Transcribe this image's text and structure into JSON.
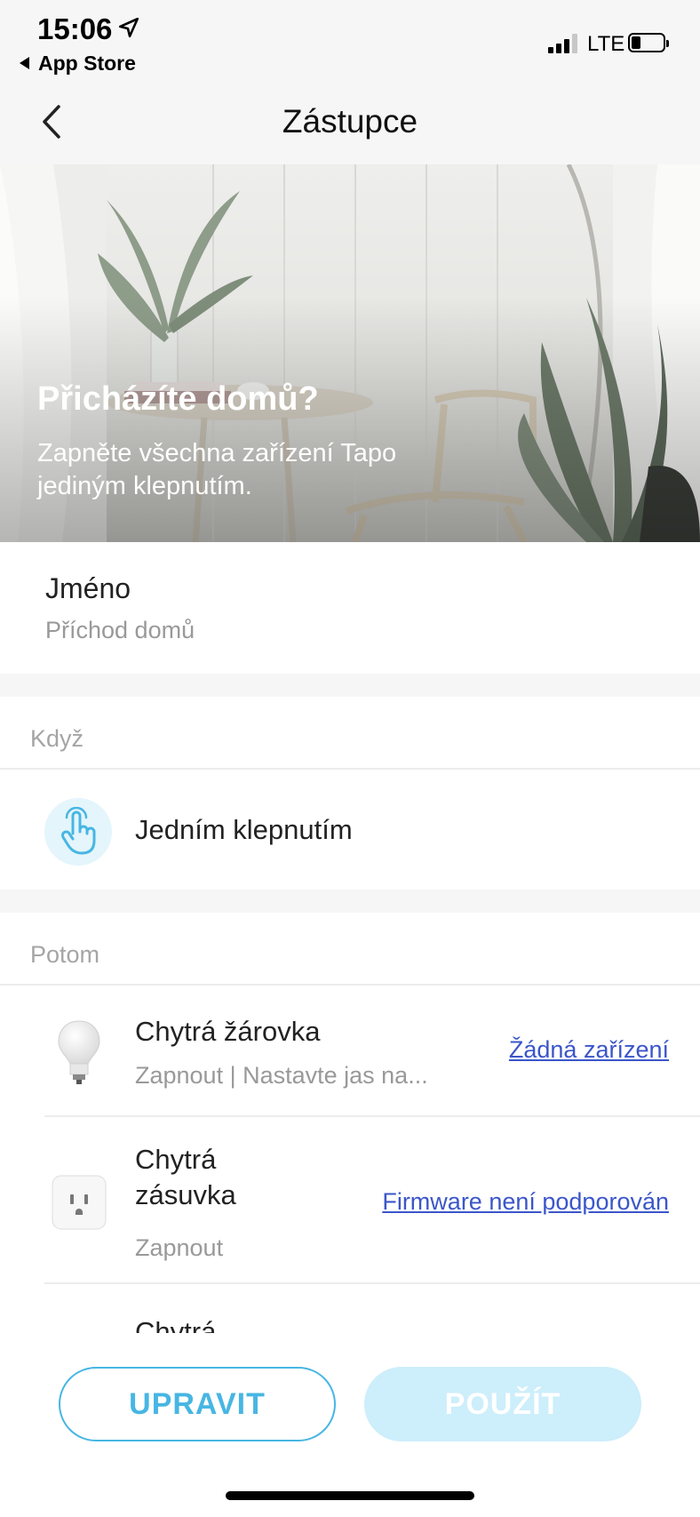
{
  "status_bar": {
    "time": "15:06",
    "back_app": "App Store",
    "network": "LTE",
    "icons": [
      "location-arrow-icon",
      "signal-icon",
      "battery-icon"
    ]
  },
  "nav": {
    "title": "Zástupce",
    "back_icon": "chevron-left-icon"
  },
  "hero": {
    "title": "Přicházíte domů?",
    "subtitle": "Zapněte všechna zařízení Tapo jediným klepnutím."
  },
  "name": {
    "label": "Jméno",
    "value": "Příchod domů"
  },
  "when": {
    "header": "Když",
    "trigger_label": "Jedním klepnutím",
    "trigger_icon": "tap-hand-icon"
  },
  "then": {
    "header": "Potom",
    "devices": [
      {
        "name": "Chytrá žárovka",
        "action": "Zapnout | Nastavte jas na...",
        "link": "Žádná zařízení",
        "icon": "smart-bulb-icon"
      },
      {
        "name": "Chytrá zásuvka",
        "action": "Zapnout",
        "link": "Firmware není podporován",
        "icon": "smart-plug-icon"
      },
      {
        "name": "Chytrá",
        "action": "",
        "link": "",
        "icon": ""
      }
    ]
  },
  "buttons": {
    "edit": "UPRAVIT",
    "apply": "POUŽÍT"
  },
  "colors": {
    "accent": "#47b6e3",
    "accent_disabled": "#cdeefb",
    "link": "#3b56c9",
    "muted_text": "#999999"
  }
}
